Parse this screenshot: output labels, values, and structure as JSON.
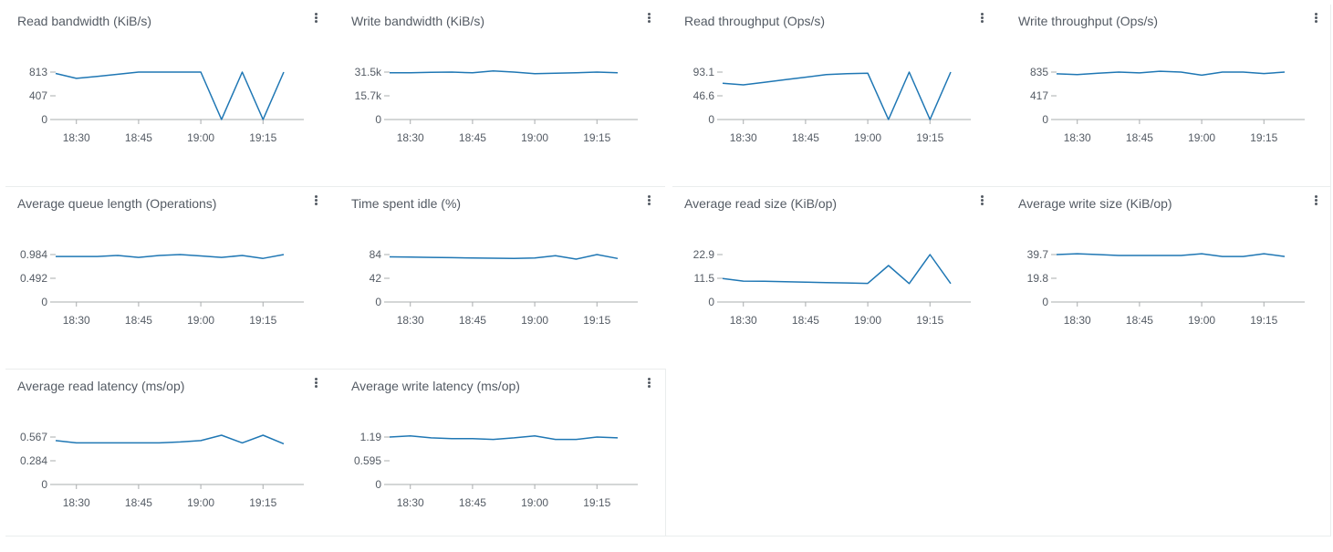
{
  "colors": {
    "series": "#1f77b4",
    "axis": "#a9acae",
    "text": "#545b64"
  },
  "menu_icon": "kebab-vertical-icon",
  "chart_data": [
    {
      "type": "line",
      "title": "Read bandwidth (KiB/s)",
      "x": [
        "18:25",
        "18:30",
        "18:35",
        "18:40",
        "18:45",
        "18:50",
        "18:55",
        "19:00",
        "19:05",
        "19:10",
        "19:15",
        "19:20"
      ],
      "values": [
        790,
        705,
        740,
        775,
        813,
        813,
        813,
        813,
        0,
        813,
        0,
        813
      ],
      "ylim": [
        0,
        813
      ],
      "yticks": [
        "0",
        "407",
        "813"
      ],
      "xticks": [
        "18:30",
        "18:45",
        "19:00",
        "19:15"
      ]
    },
    {
      "type": "line",
      "title": "Write bandwidth (KiB/s)",
      "x": [
        "18:25",
        "18:30",
        "18:35",
        "18:40",
        "18:45",
        "18:50",
        "18:55",
        "19:00",
        "19:05",
        "19:10",
        "19:15",
        "19:20"
      ],
      "values": [
        31000,
        31000,
        31300,
        31500,
        31000,
        32300,
        31500,
        30500,
        30800,
        31000,
        31500,
        31000
      ],
      "ylim": [
        0,
        31500
      ],
      "yticks": [
        "0",
        "15.7k",
        "31.5k"
      ],
      "xticks": [
        "18:30",
        "18:45",
        "19:00",
        "19:15"
      ]
    },
    {
      "type": "line",
      "title": "Read throughput (Ops/s)",
      "x": [
        "18:25",
        "18:30",
        "18:35",
        "18:40",
        "18:45",
        "18:50",
        "18:55",
        "19:00",
        "19:05",
        "19:10",
        "19:15",
        "19:20"
      ],
      "values": [
        71,
        68,
        73,
        78,
        83,
        88,
        90,
        91,
        0,
        93.1,
        0,
        93.1
      ],
      "ylim": [
        0,
        93.1
      ],
      "yticks": [
        "0",
        "46.6",
        "93.1"
      ],
      "xticks": [
        "18:30",
        "18:45",
        "19:00",
        "19:15"
      ]
    },
    {
      "type": "line",
      "title": "Write throughput (Ops/s)",
      "x": [
        "18:25",
        "18:30",
        "18:35",
        "18:40",
        "18:45",
        "18:50",
        "18:55",
        "19:00",
        "19:05",
        "19:10",
        "19:15",
        "19:20"
      ],
      "values": [
        805,
        790,
        815,
        835,
        820,
        850,
        835,
        780,
        835,
        835,
        810,
        835
      ],
      "ylim": [
        0,
        835
      ],
      "yticks": [
        "0",
        "417",
        "835"
      ],
      "xticks": [
        "18:30",
        "18:45",
        "19:00",
        "19:15"
      ]
    },
    {
      "type": "line",
      "title": "Average queue length (Operations)",
      "x": [
        "18:25",
        "18:30",
        "18:35",
        "18:40",
        "18:45",
        "18:50",
        "18:55",
        "19:00",
        "19:05",
        "19:10",
        "19:15",
        "19:20"
      ],
      "values": [
        0.945,
        0.945,
        0.945,
        0.965,
        0.925,
        0.965,
        0.984,
        0.955,
        0.925,
        0.965,
        0.905,
        0.984
      ],
      "ylim": [
        0,
        0.984
      ],
      "yticks": [
        "0",
        "0.492",
        "0.984"
      ],
      "xticks": [
        "18:30",
        "18:45",
        "19:00",
        "19:15"
      ]
    },
    {
      "type": "line",
      "title": "Time spent idle (%)",
      "x": [
        "18:25",
        "18:30",
        "18:35",
        "18:40",
        "18:45",
        "18:50",
        "18:55",
        "19:00",
        "19:05",
        "19:10",
        "19:15",
        "19:20"
      ],
      "values": [
        80,
        79.5,
        79,
        78.5,
        78,
        77.5,
        77,
        78,
        82,
        76,
        84,
        77
      ],
      "ylim": [
        0,
        84
      ],
      "yticks": [
        "0",
        "42",
        "84"
      ],
      "xticks": [
        "18:30",
        "18:45",
        "19:00",
        "19:15"
      ]
    },
    {
      "type": "line",
      "title": "Average read size (KiB/op)",
      "x": [
        "18:25",
        "18:30",
        "18:35",
        "18:40",
        "18:45",
        "18:50",
        "18:55",
        "19:00",
        "19:05",
        "19:10",
        "19:15",
        "19:20"
      ],
      "values": [
        11.3,
        10.1,
        10.0,
        9.8,
        9.6,
        9.4,
        9.2,
        9.0,
        17.6,
        8.9,
        22.9,
        8.9
      ],
      "ylim": [
        0,
        22.9
      ],
      "yticks": [
        "0",
        "11.5",
        "22.9"
      ],
      "xticks": [
        "18:30",
        "18:45",
        "19:00",
        "19:15"
      ]
    },
    {
      "type": "line",
      "title": "Average write size (KiB/op)",
      "x": [
        "18:25",
        "18:30",
        "18:35",
        "18:40",
        "18:45",
        "18:50",
        "18:55",
        "19:00",
        "19:05",
        "19:10",
        "19:15",
        "19:20"
      ],
      "values": [
        39.7,
        40.4,
        39.7,
        38.9,
        38.9,
        38.9,
        38.9,
        40.4,
        38.1,
        38.1,
        40.4,
        38.1
      ],
      "ylim": [
        0,
        39.7
      ],
      "yticks": [
        "0",
        "19.8",
        "39.7"
      ],
      "xticks": [
        "18:30",
        "18:45",
        "19:00",
        "19:15"
      ]
    },
    {
      "type": "line",
      "title": "Average read latency (ms/op)",
      "x": [
        "18:25",
        "18:30",
        "18:35",
        "18:40",
        "18:45",
        "18:50",
        "18:55",
        "19:00",
        "19:05",
        "19:10",
        "19:15",
        "19:20"
      ],
      "values": [
        0.525,
        0.497,
        0.497,
        0.497,
        0.497,
        0.497,
        0.508,
        0.525,
        0.589,
        0.497,
        0.589,
        0.486
      ],
      "ylim": [
        0,
        0.567
      ],
      "yticks": [
        "0",
        "0.284",
        "0.567"
      ],
      "xticks": [
        "18:30",
        "18:45",
        "19:00",
        "19:15"
      ]
    },
    {
      "type": "line",
      "title": "Average write latency (ms/op)",
      "x": [
        "18:25",
        "18:30",
        "18:35",
        "18:40",
        "18:45",
        "18:50",
        "18:55",
        "19:00",
        "19:05",
        "19:10",
        "19:15",
        "19:20"
      ],
      "values": [
        1.19,
        1.22,
        1.17,
        1.15,
        1.15,
        1.13,
        1.17,
        1.22,
        1.13,
        1.13,
        1.19,
        1.17
      ],
      "ylim": [
        0,
        1.19
      ],
      "yticks": [
        "0",
        "0.595",
        "1.19"
      ],
      "xticks": [
        "18:30",
        "18:45",
        "19:00",
        "19:15"
      ]
    }
  ]
}
